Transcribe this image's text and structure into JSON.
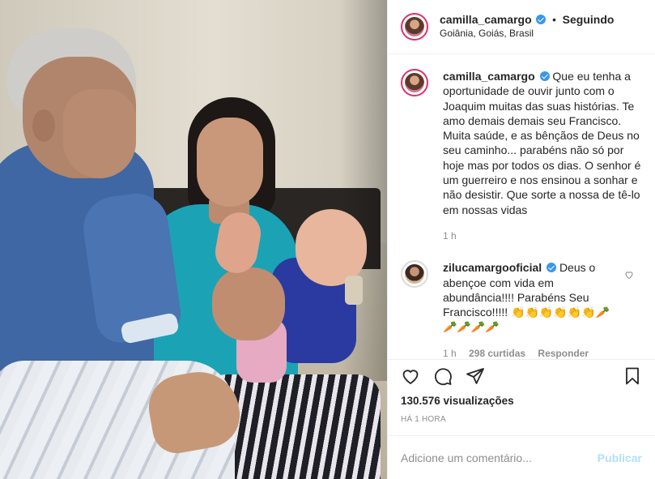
{
  "header": {
    "username": "camilla_camargo",
    "follow_status": "Seguindo",
    "separator": "•",
    "location": "Goiânia, Goiás, Brasil"
  },
  "caption": {
    "username": "camilla_camargo",
    "text": "Que eu tenha a oportunidade de ouvir junto com o Joaquim muitas das suas histórias. Te amo demais demais seu Francisco. Muita saúde, e as bênçãos de Deus no seu caminho... parabéns não só por hoje mas por todos os dias. O senhor é um guerreiro e nos ensinou a sonhar e não desistir. Que sorte a nossa de tê-lo em nossas vidas",
    "time": "1 h"
  },
  "comments": [
    {
      "username": "zilucamargooficial",
      "text": "Deus o abençoe com vida em abundância!!!! Parabéns Seu Francisco!!!!! 👏👏👏👏👏👏🥕 🥕🥕🥕🥕",
      "time": "1 h",
      "likes": "298 curtidas",
      "reply_label": "Responder"
    }
  ],
  "stats": {
    "views": "130.576 visualizações",
    "timestamp": "HÁ 1 HORA"
  },
  "comment_box": {
    "placeholder": "Adicione um comentário...",
    "publish_label": "Publicar"
  },
  "icons": {
    "like": "heart-icon",
    "comment": "comment-icon",
    "share": "share-icon",
    "save": "bookmark-icon",
    "verified": "verified-badge-icon"
  },
  "colors": {
    "verified": "#3897f0",
    "publish_disabled": "#b2dffc",
    "muted_text": "#8e8e8e"
  }
}
